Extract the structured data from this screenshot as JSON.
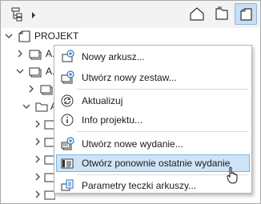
{
  "toolbar": {
    "view_menu_icon": "tree-view-options-icon",
    "buttons": [
      {
        "icon": "house-icon",
        "active": false
      },
      {
        "icon": "layouts-icon",
        "active": false
      },
      {
        "icon": "sheet-book-icon",
        "active": true
      }
    ]
  },
  "tree": {
    "root": {
      "label": "PROJEKT",
      "expanded": true
    },
    "rows": [
      {
        "label": "A.C",
        "expanded": false
      },
      {
        "label": "A.C",
        "expanded": true
      },
      {
        "label": "A",
        "expanded": false
      },
      {
        "label": "A",
        "expanded": true
      }
    ]
  },
  "context_menu": {
    "items": [
      {
        "label": "Nowy arkusz...",
        "icon": "new-sheet-icon"
      },
      {
        "label": "Utwórz nowy zestaw...",
        "icon": "new-set-icon"
      },
      {
        "label": "Aktualizuj",
        "icon": "refresh-icon"
      },
      {
        "label": "Info projektu...",
        "icon": "info-icon"
      },
      {
        "label": "Utwórz nowe wydanie...",
        "icon": "new-issue-icon"
      },
      {
        "label": "Otwórz ponownie ostatnie wydanie",
        "icon": "reopen-issue-icon",
        "highlighted": true
      },
      {
        "label": "Parametry teczki arkuszy...",
        "icon": "book-settings-icon"
      }
    ]
  },
  "colors": {
    "highlight_bg": "#cfe3f7",
    "highlight_border": "#7eb4ea",
    "active_button_bg": "#c9def3",
    "accent_blue": "#2f78c8"
  }
}
